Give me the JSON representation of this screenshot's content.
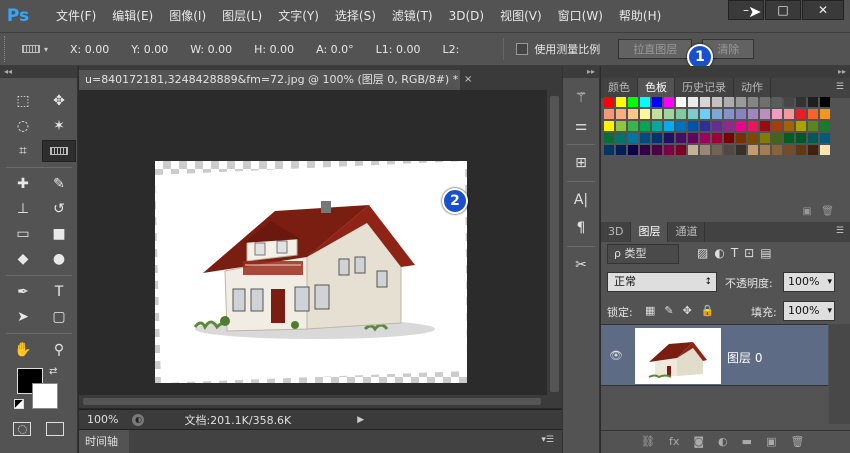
{
  "app": {
    "logo": "Ps",
    "menu": [
      "文件(F)",
      "编辑(E)",
      "图像(I)",
      "图层(L)",
      "文字(Y)",
      "选择(S)",
      "滤镜(T)",
      "3D(D)",
      "视图(V)",
      "窗口(W)",
      "帮助(H)"
    ],
    "window_buttons": {
      "minimize": "–",
      "maximize": "□",
      "close": "✕"
    }
  },
  "options_bar": {
    "x": "X: 0.00",
    "y": "Y: 0.00",
    "w": "W: 0.00",
    "h": "H: 0.00",
    "a": "A: 0.0°",
    "l1": "L1: 0.00",
    "l2": "L2:",
    "use_measure_scale": "使用测量比例",
    "straighten_btn": "拉直图层",
    "clear_btn": "清除"
  },
  "callouts": {
    "one": "1",
    "two": "2"
  },
  "document": {
    "tab_title": "u=840172181,3248428889&fm=72.jpg @ 100% (图层 0, RGB/8#) *",
    "tab_close": "×",
    "zoom": "100%",
    "doc_size": "文档:201.1K/358.6K",
    "timeline_tab": "时间轴"
  },
  "panels": {
    "color_tabs": [
      "颜色",
      "色板",
      "历史记录",
      "动作"
    ],
    "color_active": "色板",
    "layer_tabs": [
      "3D",
      "图层",
      "通道"
    ],
    "layer_active": "图层",
    "kind_filter": "ρ 类型",
    "blend_mode": "正常",
    "opacity_label": "不透明度:",
    "opacity_value": "100%",
    "lock_label": "锁定:",
    "fill_label": "填充:",
    "fill_value": "100%",
    "layer_name": "图层 0"
  },
  "swatches": [
    "#ff0000",
    "#ffff00",
    "#00ff00",
    "#00ffff",
    "#0000ff",
    "#ff00ff",
    "#ffffff",
    "#ebebeb",
    "#d6d6d6",
    "#c2c2c2",
    "#adadad",
    "#999999",
    "#858585",
    "#707070",
    "#5c5c5c",
    "#474747",
    "#333333",
    "#1f1f1f",
    "#000000",
    "#f7977a",
    "#f9ad81",
    "#fdc68a",
    "#fff79a",
    "#c4df9b",
    "#a3d39c",
    "#82ca9d",
    "#7bcdc8",
    "#6ecff6",
    "#7ea7d8",
    "#8493ca",
    "#8882be",
    "#a187be",
    "#bc8dbf",
    "#f49ac2",
    "#f6989d",
    "#ed1c24",
    "#f26522",
    "#f7941d",
    "#fff200",
    "#8dc63f",
    "#39b54a",
    "#00a651",
    "#00a99d",
    "#00aeef",
    "#0072bc",
    "#0054a6",
    "#2e3192",
    "#662d91",
    "#92278f",
    "#ec008c",
    "#ed145b",
    "#9e0b0f",
    "#a0410d",
    "#a36209",
    "#aba000",
    "#598527",
    "#197b30",
    "#007236",
    "#00746b",
    "#0076a3",
    "#004b80",
    "#003471",
    "#1b1464",
    "#440e62",
    "#630460",
    "#9e005d",
    "#9e0039",
    "#790000",
    "#7b2e00",
    "#7d4900",
    "#827b00",
    "#406618",
    "#005e20",
    "#005826",
    "#005952",
    "#005b7f",
    "#003663",
    "#002157",
    "#0d004c",
    "#32004b",
    "#4b0049",
    "#7b0046",
    "#7a0026",
    "#c7b299",
    "#998675",
    "#736357",
    "#534741",
    "#37302d",
    "#c69c6d",
    "#a67c52",
    "#8c6239",
    "#754c24",
    "#603913",
    "#42210b",
    "#fbe3b2"
  ]
}
